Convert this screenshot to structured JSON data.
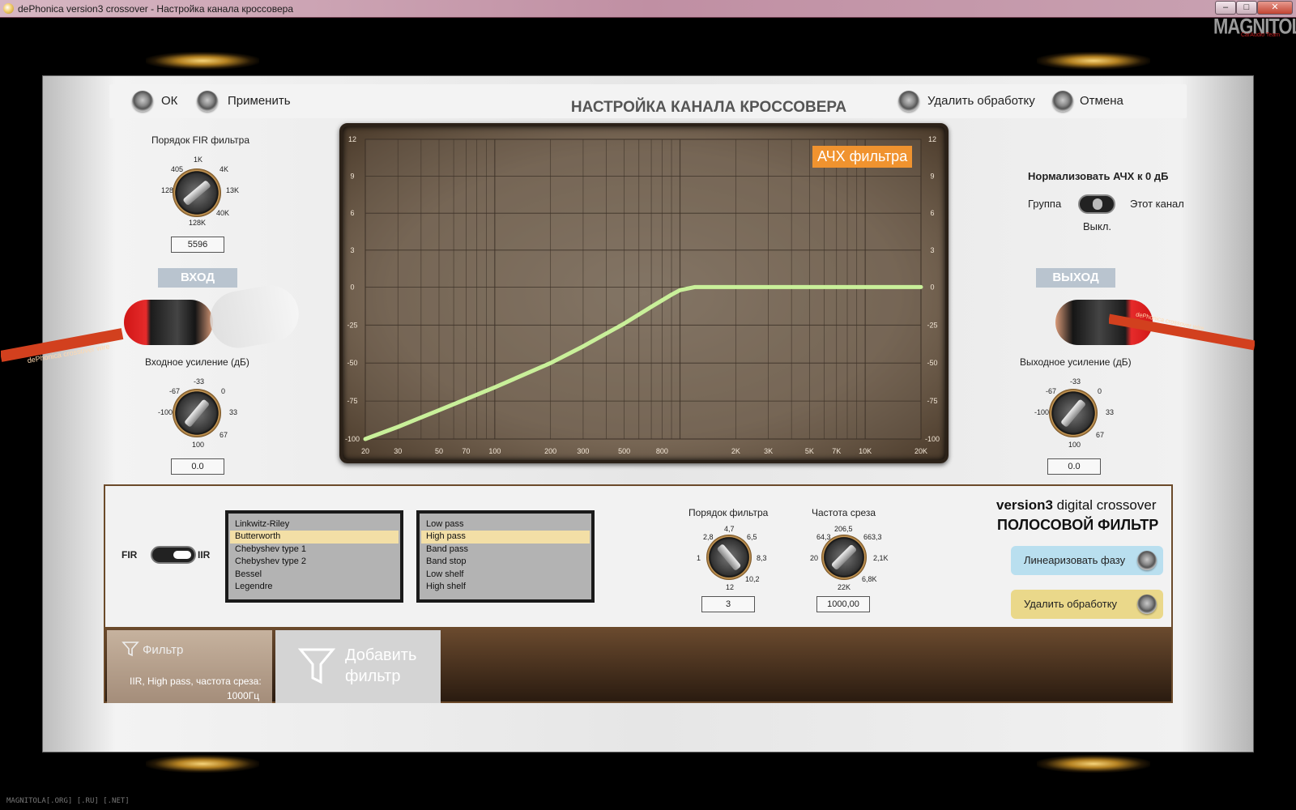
{
  "window": {
    "title": "dePhonica version3 crossover - Настройка канала кроссовера",
    "min": "–",
    "max": "□",
    "close": "✕"
  },
  "logo": {
    "text": "MAGNITOLA",
    "sub": "CarAudio Team"
  },
  "toolbar": {
    "ok": "ОК",
    "apply": "Применить",
    "title": "НАСТРОЙКА КАНАЛА КРОССОВЕРА",
    "remove": "Удалить обработку",
    "cancel": "Отмена"
  },
  "fir_order": {
    "label": "Порядок FIR фильтра",
    "ticks": [
      "1K",
      "4K",
      "13K",
      "40K",
      "128K",
      "128",
      "405"
    ],
    "value": "5596"
  },
  "input": {
    "badge": "ВХОД",
    "gain_label": "Входное усиление (дБ)",
    "ticks": [
      "-33",
      "0",
      "33",
      "67",
      "100",
      "-100",
      "-67"
    ],
    "value": "0.0",
    "cable_text": "dePhonica crossover wire"
  },
  "output": {
    "badge": "ВЫХОД",
    "gain_label": "Выходное усиление (дБ)",
    "ticks": [
      "-33",
      "0",
      "33",
      "67",
      "100",
      "-100",
      "-67"
    ],
    "value": "0.0",
    "cable_text": "dePhonica crossover wire"
  },
  "normalize": {
    "title": "Нормализовать АЧХ к 0 дБ",
    "left": "Группа",
    "right": "Этот канал",
    "state": "Выкл."
  },
  "chart_data": {
    "type": "line",
    "title": "АЧХ фильтра",
    "xscale": "log",
    "xlim": [
      20,
      20000
    ],
    "ylim": [
      -100,
      12
    ],
    "xticks": [
      "20",
      "30",
      "50",
      "70",
      "100",
      "200",
      "300",
      "500",
      "800",
      "2K",
      "3K",
      "5K",
      "7K",
      "10K",
      "20K"
    ],
    "xtick_values": [
      20,
      30,
      50,
      70,
      100,
      200,
      300,
      500,
      800,
      2000,
      3000,
      5000,
      7000,
      10000,
      20000
    ],
    "yticks": [
      "12",
      "9",
      "6",
      "3",
      "0",
      "-25",
      "-50",
      "-75",
      "-100"
    ],
    "grid": true,
    "series": [
      {
        "color": "#c9f09a",
        "x": [
          20,
          30,
          50,
          100,
          200,
          300,
          500,
          700,
          900,
          1000,
          1200,
          1500,
          2000,
          5000,
          10000,
          20000
        ],
        "y": [
          -100,
          -92,
          -81,
          -66,
          -50,
          -39,
          -24,
          -13,
          -5,
          -2,
          0,
          0,
          0,
          0,
          0,
          0
        ]
      }
    ]
  },
  "filter_panel": {
    "mode_left": "FIR",
    "mode_right": "IIR",
    "types": [
      "Linkwitz-Riley",
      "Butterworth",
      "Chebyshev type 1",
      "Chebyshev type 2",
      "Bessel",
      "Legendre"
    ],
    "types_selected": 1,
    "modes": [
      "Low pass",
      "High pass",
      "Band pass",
      "Band stop",
      "Low shelf",
      "High shelf"
    ],
    "modes_selected": 1,
    "order": {
      "label": "Порядок фильтра",
      "ticks": [
        "4,7",
        "6,5",
        "8,3",
        "10,2",
        "12",
        "1",
        "2,8"
      ],
      "value": "3"
    },
    "cutoff": {
      "label": "Частота среза",
      "ticks": [
        "206,5",
        "663,3",
        "2,1K",
        "6,8K",
        "22K",
        "20",
        "64,3"
      ],
      "value": "1000,00"
    },
    "brand_bold": "version3",
    "brand_rest": " digital crossover",
    "title": "ПОЛОСОВОЙ ФИЛЬТР",
    "linearize": "Линеаризовать фазу",
    "remove": "Удалить обработку",
    "colors": {
      "linearize": "#b9dfef",
      "remove": "#ead88a"
    }
  },
  "filter_tray": {
    "filter_title": "Фильтр",
    "filter_desc1": "IIR, High pass, частота среза:",
    "filter_desc2": "1000Гц",
    "add_line1": "Добавить",
    "add_line2": "фильтр"
  },
  "footer": "MAGNITOLA[.ORG] [.RU] [.NET]"
}
